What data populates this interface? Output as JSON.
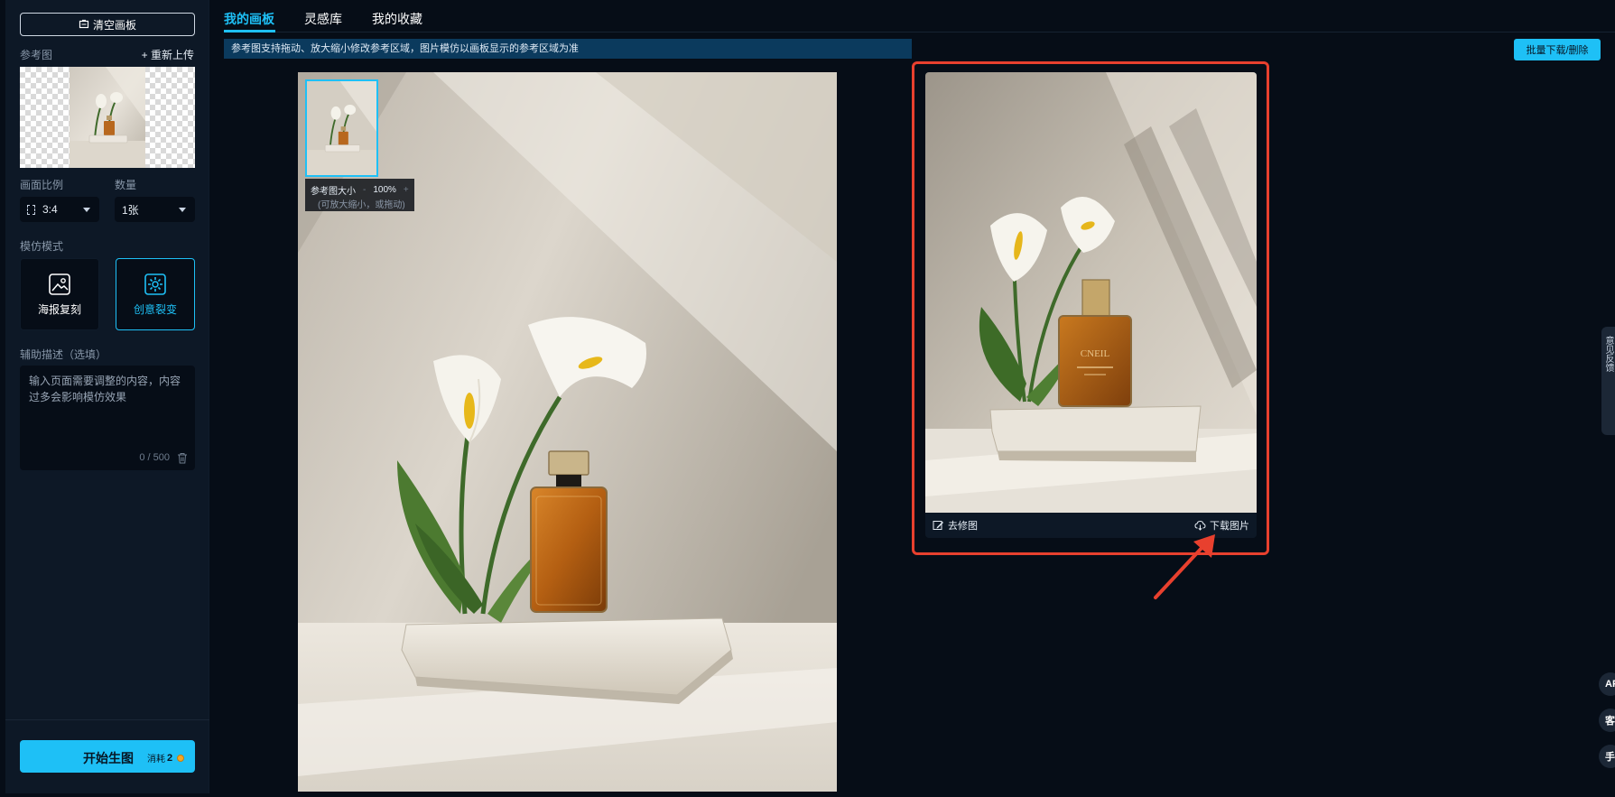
{
  "sidebar": {
    "clear_label": "清空画板",
    "ref_label": "参考图",
    "reupload_label": "+ 重新上传",
    "ratio_label": "画面比例",
    "ratio_value": "3:4",
    "count_label": "数量",
    "count_value": "1张",
    "mode_label": "模仿模式",
    "modes": [
      {
        "label": "海报复刻",
        "active": false
      },
      {
        "label": "创意裂变",
        "active": true
      }
    ],
    "desc_label": "辅助描述（选填）",
    "desc_placeholder": "输入页面需要调整的内容，内容过多会影响模仿效果",
    "desc_counter": "0 / 500",
    "start_label": "开始生图",
    "cost_prefix": "消耗",
    "cost_value": "2"
  },
  "tabs": [
    {
      "label": "我的画板",
      "active": true
    },
    {
      "label": "灵感库",
      "active": false
    },
    {
      "label": "我的收藏",
      "active": false
    }
  ],
  "notice": "参考图支持拖动、放大缩小修改参考区域，图片模仿以画板显示的参考区域为准",
  "batch_label": "批量下载/删除",
  "zoom": {
    "label": "参考图大小",
    "minus": "-",
    "value": "100%",
    "plus": "+",
    "hint": "(可放大缩小，或拖动)"
  },
  "result": {
    "retouch_label": "去修图",
    "download_label": "下载图片",
    "bottle_text": "CNEIL"
  },
  "right_edge": {
    "side_tab": "意见反馈",
    "float_buttons": [
      "API",
      "客服",
      "手机"
    ]
  },
  "colors": {
    "accent": "#1ec0f6",
    "highlight_frame": "#e8402e",
    "background": "#060d17",
    "panel": "#0d1826"
  }
}
